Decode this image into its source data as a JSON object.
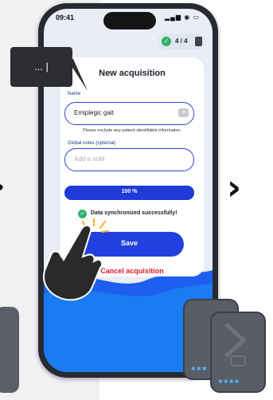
{
  "status_bar": {
    "time": "09:41",
    "icons": "signal-wifi-battery"
  },
  "counter": {
    "text": "4 / 4"
  },
  "form": {
    "title": "New acquisition",
    "name_label": "Name",
    "name_value": "Emiplegic gait",
    "hint": "Please exclude any patient identifiable information.",
    "notes_label": "Global notes (optional)",
    "notes_placeholder": "Add a note"
  },
  "progress": {
    "value": 100,
    "label": "100 %"
  },
  "sync": {
    "message": "Data synchronized successfully!"
  },
  "actions": {
    "save_label": "Save",
    "cancel_label": "Cancel acquisition"
  },
  "tooltip": {
    "text": "... |"
  },
  "colors": {
    "primary": "#2240e0",
    "success": "#2fb36b",
    "danger": "#e5192f",
    "device": "#585d66"
  },
  "icons": [
    "check-circle-icon",
    "device-box-icon",
    "clear-icon",
    "chevron-right-icon",
    "tap-hand-icon"
  ]
}
